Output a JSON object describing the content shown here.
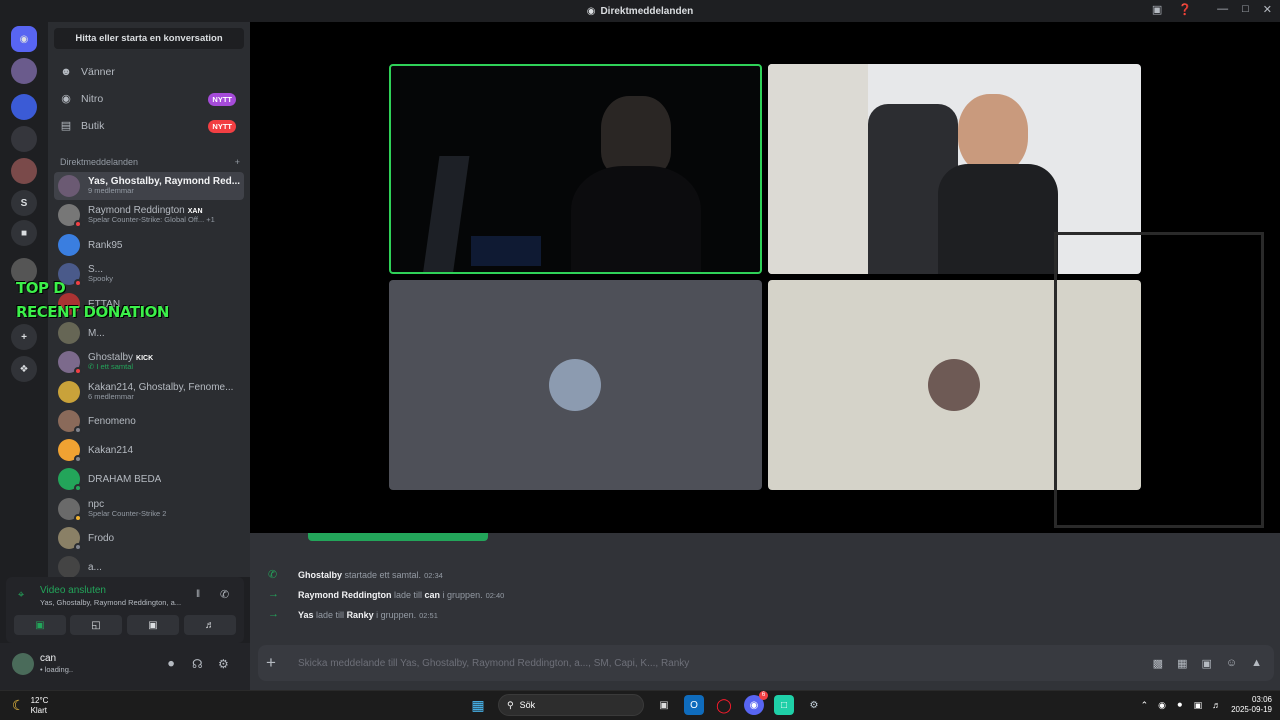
{
  "window": {
    "title": "Direktmeddelanden"
  },
  "sidebar": {
    "search_label": "Hitta eller starta en konversation",
    "nav": [
      {
        "label": "Vänner",
        "icon": "friends-icon"
      },
      {
        "label": "Nitro",
        "icon": "nitro-icon",
        "badge": "NYTT"
      },
      {
        "label": "Butik",
        "icon": "shop-icon",
        "badge": "NYTT"
      }
    ],
    "dm_header": "Direktmeddelanden",
    "dms": [
      {
        "name": "Yas, Ghostalby, Raymond Red...",
        "sub": "9 medlemmar"
      },
      {
        "name": "Raymond Reddington",
        "tag": "XAN",
        "sub": "Spelar Counter-Strike: Global Off...",
        "extra": "+1"
      },
      {
        "name": "Rank95",
        "sub": ""
      },
      {
        "name": "S...",
        "sub": "Spooky"
      },
      {
        "name": "ETTAN",
        "sub": ""
      },
      {
        "name": "M...",
        "sub": ""
      },
      {
        "name": "Ghostalby",
        "tag": "KICK",
        "sub": "I ett samtal"
      },
      {
        "name": "Kakan214, Ghostalby, Fenome...",
        "sub": "6 medlemmar"
      },
      {
        "name": "Fenomeno",
        "sub": ""
      },
      {
        "name": "Kakan214",
        "sub": ""
      },
      {
        "name": "DRAHAM BEDA",
        "sub": ""
      },
      {
        "name": "npc",
        "sub": "Spelar Counter-Strike 2"
      },
      {
        "name": "Frodo",
        "sub": ""
      },
      {
        "name": "a...",
        "sub": ""
      }
    ]
  },
  "overlay": {
    "line1": "TOP D",
    "line2": "RECENT DONATION"
  },
  "voice": {
    "title": "Video ansluten",
    "sub": "Yas, Ghostalby, Raymond Reddington, a..."
  },
  "user": {
    "name": "can",
    "status": "• loading.."
  },
  "messages": [
    {
      "user": "Ghostalby",
      "text": " startade ett samtal.",
      "time": "02:34",
      "icon": "phone-icon"
    },
    {
      "user": "Raymond Reddington",
      "text": " lade till ",
      "target": "can",
      "text2": " i gruppen.",
      "time": "02:40",
      "icon": "arrow-icon"
    },
    {
      "user": "Yas",
      "text": " lade till ",
      "target": "Ranky",
      "text2": " i gruppen.",
      "time": "02:51",
      "icon": "arrow-icon"
    }
  ],
  "composer": {
    "placeholder": "Skicka meddelande till Yas, Ghostalby, Raymond Reddington, a..., SM, Capi, K..., Ranky"
  },
  "taskbar": {
    "temp": "12°C",
    "weather": "Klart",
    "search": "Sök",
    "time": "03:06",
    "date": "2025-09-19",
    "discord_badge": "6"
  }
}
